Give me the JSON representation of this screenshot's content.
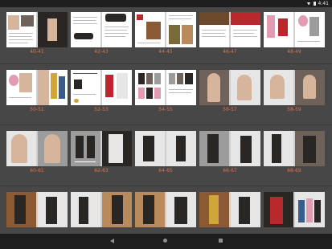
{
  "status_bar": {
    "time": "4:41"
  },
  "gallery": {
    "spreads": [
      {
        "label": "40-41"
      },
      {
        "label": "42-43"
      },
      {
        "label": "44-45"
      },
      {
        "label": "46-47"
      },
      {
        "label": "48-49"
      },
      {
        "label": "50-51"
      },
      {
        "label": "52-53"
      },
      {
        "label": "54-55"
      },
      {
        "label": "56-57"
      },
      {
        "label": "58-59"
      },
      {
        "label": "60-61"
      },
      {
        "label": "62-63"
      },
      {
        "label": "64-65"
      },
      {
        "label": "66-67"
      },
      {
        "label": "68-69"
      },
      {
        "label": "",
        "hidden_label": true
      },
      {
        "label": ""
      },
      {
        "label": ""
      },
      {
        "label": ""
      },
      {
        "label": ""
      }
    ]
  },
  "colors": {
    "background": "#474747",
    "label": "#e0734a",
    "bars": "#1e1e1e",
    "page": "#ffffff"
  },
  "icons": {
    "wifi": "wifi-icon",
    "battery": "battery-icon",
    "back": "back-icon",
    "home": "home-icon",
    "recents": "recents-icon"
  }
}
